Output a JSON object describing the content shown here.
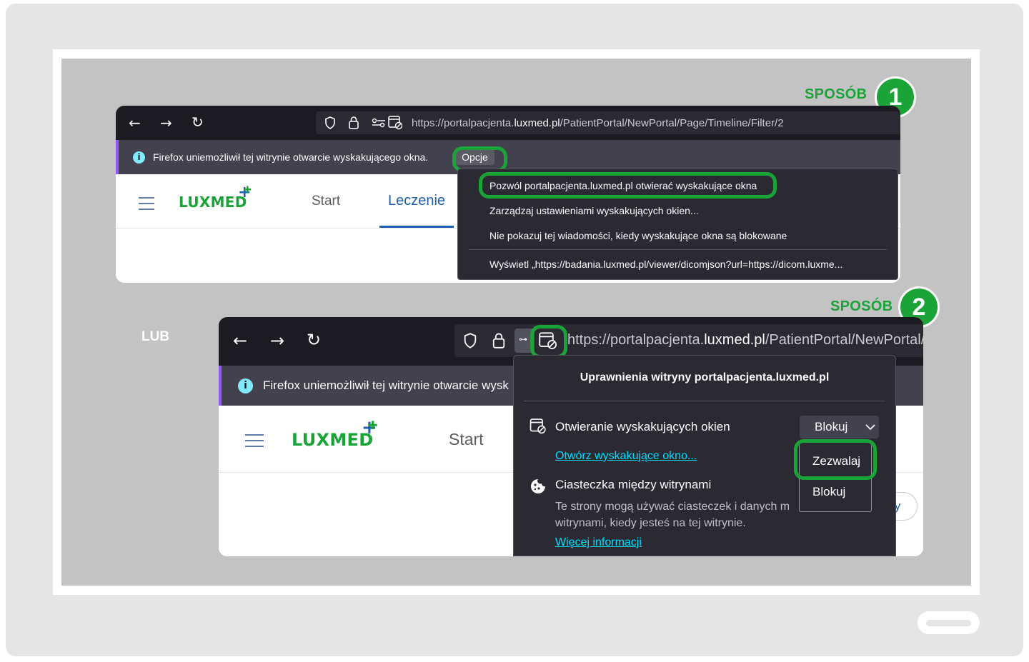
{
  "steps": {
    "step1_label": "SPOSÓB",
    "step1_num": "1",
    "step2_label": "SPOSÓB",
    "step2_num": "2",
    "or_label": "LUB"
  },
  "browser1": {
    "url_prefix": "https://portalpacjenta.",
    "url_domain": "luxmed.pl",
    "url_suffix": "/PatientPortal/NewPortal/Page/Timeline/Filter/2",
    "notification_text": "Firefox uniemożliwił tej witrynie otwarcie wyskakującego okna.",
    "options_button": "Opcje",
    "site_logo": "LUXMED",
    "nav_start": "Start",
    "nav_leczenie": "Leczenie",
    "menu": {
      "allow_item": "Pozwól portalpacjenta.luxmed.pl otwierać wyskakujące okna",
      "manage_item": "Zarządzaj ustawieniami wyskakujących okien...",
      "dont_show_item": "Nie pokazuj tej wiadomości, kiedy wyskakujące okna są blokowane",
      "show_item": "Wyświetl „https://badania.luxmed.pl/viewer/dicomjson?url=https://dicom.luxme..."
    }
  },
  "browser2": {
    "url_prefix": "https://portalpacjenta.",
    "url_domain": "luxmed.pl",
    "url_suffix": "/PatientPortal/NewPortal/",
    "notification_text": "Firefox uniemożliwił tej witrynie otwarcie wysk",
    "site_logo": "LUXMED",
    "nav_start": "Start",
    "partial_button": "ty",
    "panel": {
      "title": "Uprawnienia witryny portalpacjenta.luxmed.pl",
      "popup_label": "Otwieranie wyskakujących okien",
      "select_value": "Blokuj",
      "open_popup_link": "Otwórz wyskakujące okno...",
      "cookies_label": "Ciasteczka między witrynami",
      "cookies_desc": "Te strony mogą używać ciasteczek i danych m witrynami, kiedy jesteś na tej witrynie.",
      "more_info_link": "Więcej informacji"
    },
    "dropdown": {
      "option_allow": "Zezwalaj",
      "option_block": "Blokuj"
    }
  },
  "colors": {
    "accent_green": "#1aa336",
    "firefox_dark": "#1c1b22",
    "link_cyan": "#00ddff",
    "luxmed_blue": "#1a5fb4"
  }
}
